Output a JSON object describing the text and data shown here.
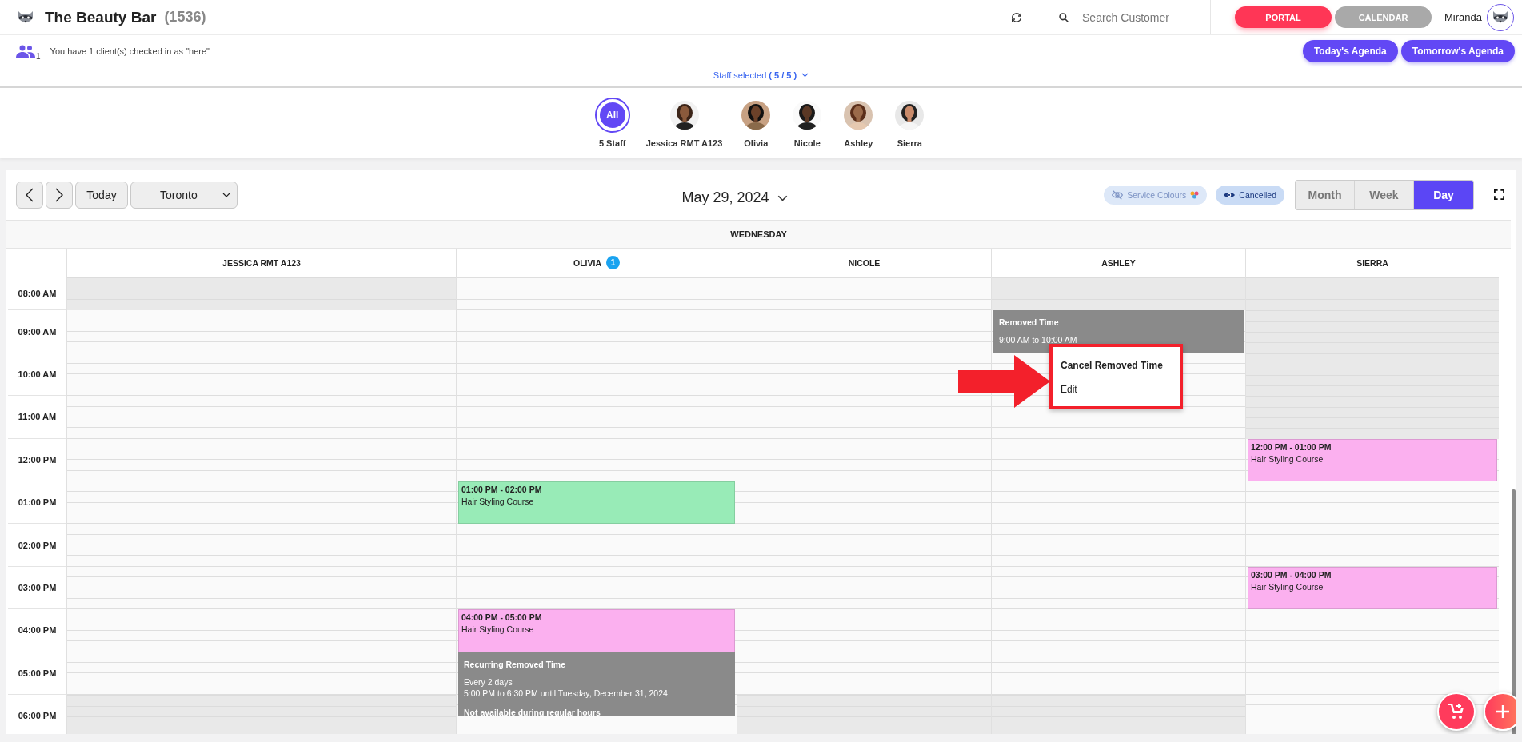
{
  "header": {
    "title": "The Beauty Bar",
    "count": "(1536)",
    "search": {
      "placeholder": "Search Customer"
    },
    "nav": [
      {
        "label": "PORTAL",
        "selected": true
      },
      {
        "label": "CALENDAR",
        "selected": false
      }
    ],
    "user": "Miranda"
  },
  "checkin": {
    "count": "1",
    "message": "You have 1 client(s) checked in as \"here\""
  },
  "agenda_buttons": [
    "Today's Agenda",
    "Tomorrow's Agenda"
  ],
  "staff_selected": "Staff selected **( 5 / 5 )**",
  "staff": [
    {
      "kind": "all",
      "badge": "All",
      "name": "5 Staff",
      "selected": true
    },
    {
      "kind": "person",
      "name": "Jessica RMT A123",
      "selected": false
    },
    {
      "kind": "person",
      "name": "Olivia",
      "selected": false
    },
    {
      "kind": "person",
      "name": "Nicole",
      "selected": false
    },
    {
      "kind": "person",
      "name": "Ashley",
      "selected": false
    },
    {
      "kind": "person",
      "name": "Sierra",
      "selected": false
    }
  ],
  "calendar": {
    "today": "Today",
    "location": "Toronto",
    "date": "May 29, 2024",
    "toggles": [
      {
        "label": "Service Colours",
        "on": false
      },
      {
        "label": "Cancelled",
        "on": true
      }
    ],
    "views": [
      {
        "label": "Month",
        "selected": false
      },
      {
        "label": "Week",
        "selected": false
      },
      {
        "label": "Day",
        "selected": true
      }
    ],
    "weekday": "WEDNESDAY",
    "times": [
      "08:00 AM",
      "09:00 AM",
      "10:00 AM",
      "11:00 AM",
      "12:00 PM",
      "01:00 PM",
      "02:00 PM",
      "03:00 PM",
      "04:00 PM",
      "05:00 PM",
      "06:00 PM"
    ],
    "columns": [
      {
        "name": "JESSICA RMT A123",
        "unavailable": [
          true,
          false,
          false,
          false,
          false,
          false,
          false,
          false,
          false,
          false,
          true
        ]
      },
      {
        "name": "OLIVIA",
        "badge": "1",
        "events": [
          {
            "kind": "appointment",
            "time": "01:00 PM - 02:00 PM",
            "title": "Hair Styling Course",
            "color": "#98ebb7"
          },
          {
            "kind": "appointment",
            "time": "04:00 PM - 05:00 PM",
            "title": "Hair Styling Course",
            "color": "#fbb0ef"
          },
          {
            "kind": "recurring",
            "title": "Recurring Removed Time",
            "lines": [
              "Every 2 days",
              "5:00 PM to 6:30 PM until Tuesday, December 31, 2024"
            ],
            "note": "Not available during regular hours"
          }
        ]
      },
      {
        "name": "NICOLE",
        "unavailable": [
          false,
          false,
          false,
          false,
          false,
          false,
          false,
          false,
          false,
          false,
          true
        ]
      },
      {
        "name": "ASHLEY",
        "unavailable": [
          true,
          false,
          false,
          false,
          false,
          false,
          false,
          false,
          false,
          false,
          true
        ],
        "events": [
          {
            "kind": "removed",
            "title": "Removed Time",
            "lines": [
              "9:00 AM to 10:00 AM"
            ],
            "menu": [
              "Cancel Removed Time",
              "Edit"
            ]
          }
        ]
      },
      {
        "name": "SIERRA",
        "unavailable": [
          true,
          true,
          true,
          true,
          false,
          false,
          false,
          false,
          false,
          false,
          false
        ],
        "events": [
          {
            "kind": "appointment",
            "time": "12:00 PM - 01:00 PM",
            "title": "Hair Styling Course",
            "color": "#fbb0ef"
          },
          {
            "kind": "appointment",
            "time": "03:00 PM - 04:00 PM",
            "title": "Hair Styling Course",
            "color": "#fbb0ef"
          }
        ]
      }
    ]
  }
}
